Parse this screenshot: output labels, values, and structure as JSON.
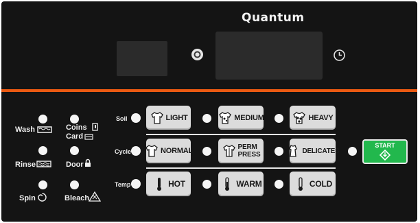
{
  "brand": "Quantum",
  "status_panel": {
    "wash": "Wash",
    "coins": "Coins",
    "card": "Card",
    "rinse": "Rinse",
    "door": "Door",
    "spin": "Spin",
    "bleach": "Bleach"
  },
  "rows": {
    "soil": "Soil",
    "cycle": "Cycle",
    "temp": "Temp"
  },
  "buttons": {
    "light": "LIGHT",
    "medium": "MEDIUM",
    "heavy": "HEAVY",
    "normal": "NORMAL",
    "perm_press_1": "PERM",
    "perm_press_2": "PRESS",
    "delicates": "DELICATES",
    "hot": "HOT",
    "warm": "WARM",
    "cold": "COLD"
  },
  "start": "START",
  "colors": {
    "panel": "#141414",
    "accent_stripe": "#ec5a12",
    "start_button": "#22b84d",
    "button_face": "#dcdcdc"
  },
  "icons": [
    "knob-icon",
    "clock-icon",
    "wash-tub-icon",
    "coin-slot-icon",
    "card-icon",
    "rinse-tub-icon",
    "door-lock-icon",
    "spin-icon",
    "bleach-triangle-icon",
    "shirt-icon",
    "thermometer-icon",
    "start-diamond-icon"
  ]
}
